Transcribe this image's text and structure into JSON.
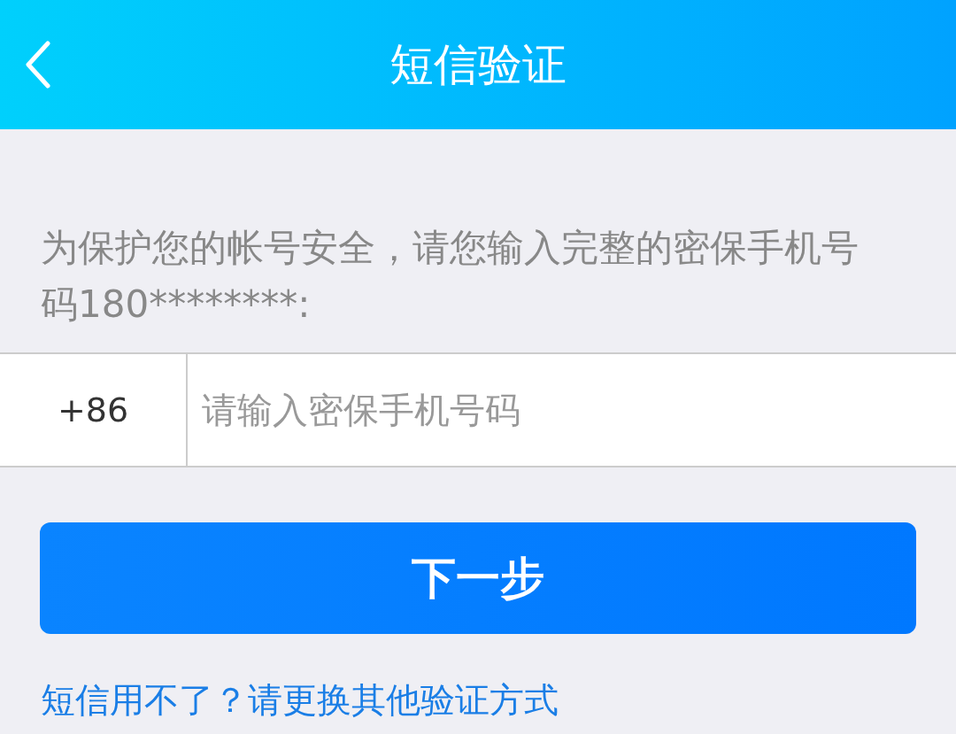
{
  "header": {
    "title": "短信验证"
  },
  "instruction": "为保护您的帐号安全，请您输入完整的密保手机号码180********:",
  "phone_field": {
    "country_code": "+86",
    "placeholder": "请输入密保手机号码"
  },
  "next_button": "下一步",
  "alternate_link": "短信用不了？请更换其他验证方式"
}
